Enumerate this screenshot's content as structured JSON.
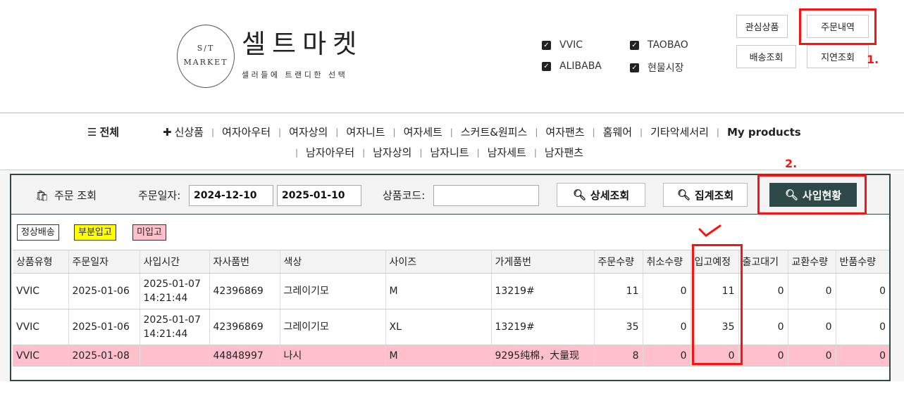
{
  "logo": {
    "top_text": "S/T",
    "bottom_text": "MARKET"
  },
  "brand": {
    "title": "셀트마켓",
    "subtitle": "셀러들에 트랜디한 선택"
  },
  "sources": [
    {
      "label": "VVIC",
      "checked": true
    },
    {
      "label": "TAOBAO",
      "checked": true
    },
    {
      "label": "ALIBABA",
      "checked": true
    },
    {
      "label": "현물시장",
      "checked": true
    }
  ],
  "header_buttons": {
    "wishlist": "관심상품",
    "orders": "주문내역",
    "shipping": "배송조회",
    "delay": "지연조회"
  },
  "annotations": {
    "step1": "1.",
    "step2": "2."
  },
  "nav": {
    "all": "전체",
    "row1": [
      "신상품",
      "여자아우터",
      "여자상의",
      "여자니트",
      "여자세트",
      "스커트&원피스",
      "여자팬츠",
      "홈웨어",
      "기타악세서리",
      "My products"
    ],
    "row2": [
      "남자아우터",
      "남자상의",
      "남자니트",
      "남자세트",
      "남자팬츠"
    ]
  },
  "search": {
    "title": "주문 조회",
    "date_label": "주문일자:",
    "date_from": "2024-12-10",
    "date_to": "2025-01-10",
    "code_label": "상품코드:",
    "code_value": "",
    "btn_detail": "상세조회",
    "btn_summary": "집계조회",
    "btn_status": "사입현황"
  },
  "legend": [
    {
      "label": "정상배송",
      "color": "#ffffff"
    },
    {
      "label": "부분입고",
      "color": "#ffff00"
    },
    {
      "label": "미입고",
      "color": "#ffc0cb"
    }
  ],
  "table": {
    "columns": [
      "상품유형",
      "주문일자",
      "사입시간",
      "자사품번",
      "색상",
      "사이즈",
      "가게품번",
      "주문수량",
      "취소수량",
      "입고예정",
      "출고대기",
      "교환수량",
      "반품수량"
    ],
    "rows": [
      {
        "type": "VVIC",
        "date": "2025-01-06",
        "time": [
          "2025-01-07",
          "14:21:44"
        ],
        "code": "42396869",
        "color": "그레이기모",
        "size": "M",
        "shop_code": "13219#",
        "order_qty": "11",
        "cancel_qty": "0",
        "incoming": "11",
        "waiting": "0",
        "exchange": "0",
        "returned": "0",
        "status": "normal"
      },
      {
        "type": "VVIC",
        "date": "2025-01-06",
        "time": [
          "2025-01-07",
          "14:21:44"
        ],
        "code": "42396869",
        "color": "그레이기모",
        "size": "XL",
        "shop_code": "13219#",
        "order_qty": "35",
        "cancel_qty": "0",
        "incoming": "35",
        "waiting": "0",
        "exchange": "0",
        "returned": "0",
        "status": "normal"
      },
      {
        "type": "VVIC",
        "date": "2025-01-08",
        "time": [
          "",
          ""
        ],
        "code": "44848997",
        "color": "나시",
        "size": "M",
        "shop_code": "9295纯棉，大量现",
        "order_qty": "8",
        "cancel_qty": "0",
        "incoming": "0",
        "waiting": "0",
        "exchange": "0",
        "returned": "0",
        "status": "not_received"
      }
    ]
  }
}
